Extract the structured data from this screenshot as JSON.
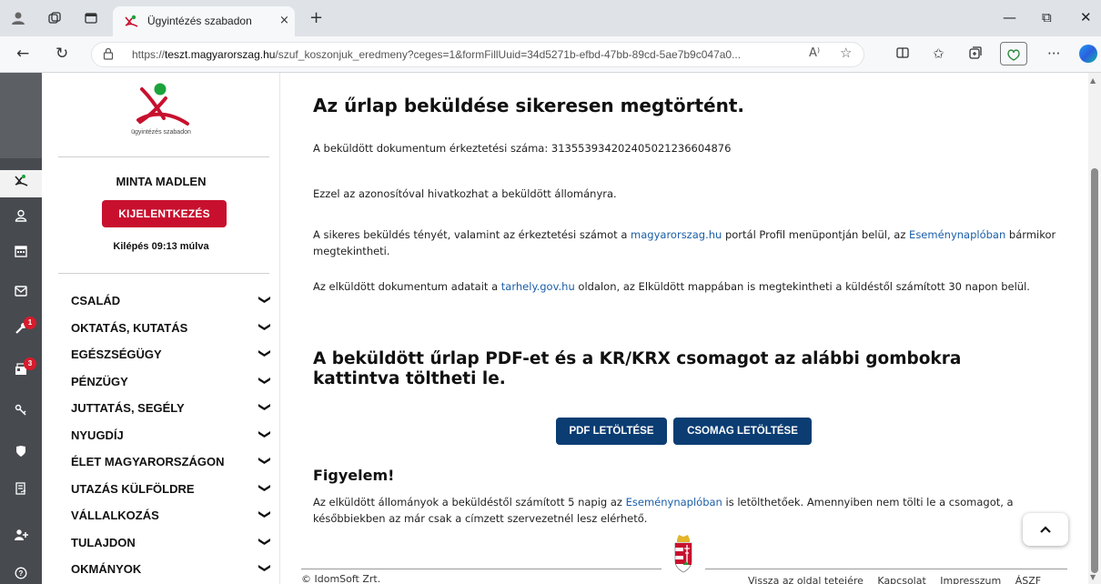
{
  "browser": {
    "tab_title": "Ügyintézés szabadon",
    "tab_close": "×",
    "new_tab": "+",
    "url_prefix": "https://",
    "url_host": "teszt.magyarorszag.hu",
    "url_rest": "/szuf_koszonjuk_eredmeny?ceges=1&formFillUuid=34d5271b-efbd-47bb-89cd-5ae7b9c047a0...",
    "read_aloud": "A⁾",
    "window_minimize": "—",
    "window_restore": "⧉",
    "window_close": "✕",
    "more": "···"
  },
  "rail": {
    "badges": {
      "tools": "1",
      "docs": "3"
    }
  },
  "sidebar": {
    "logo_text": "ügyintézés szabadon",
    "user_name": "MINTA MADLEN",
    "logout_label": "KIJELENTKEZÉS",
    "logout_timer": "Kilépés 09:13 múlva",
    "menu": [
      {
        "label": "CSALÁD"
      },
      {
        "label": "OKTATÁS, KUTATÁS"
      },
      {
        "label": "EGÉSZSÉGÜGY"
      },
      {
        "label": "PÉNZÜGY"
      },
      {
        "label": "JUTTATÁS, SEGÉLY"
      },
      {
        "label": "NYUGDÍJ"
      },
      {
        "label": "ÉLET MAGYARORSZÁGON"
      },
      {
        "label": "UTAZÁS KÜLFÖLDRE"
      },
      {
        "label": "VÁLLALKOZÁS"
      },
      {
        "label": "TULAJDON"
      },
      {
        "label": "OKMÁNYOK"
      }
    ]
  },
  "main": {
    "title": "Az űrlap beküldése sikeresen megtörtént.",
    "reg_number_text": "A beküldött dokumentum érkeztetési száma: 313553934202405021236604876",
    "reference_text": "Ezzel az azonosítóval hivatkozhat a beküldött állományra.",
    "profile_p1": "A sikeres beküldés tényét, valamint az érkeztetési számot a ",
    "profile_link1": "magyarorszag.hu",
    "profile_p2": " portál Profil menüpontján belül, az ",
    "profile_link2": "Eseménynaplóban",
    "profile_p3": " bármikor megtekintheti.",
    "tarhely_p1": "Az elküldött dokumentum adatait a ",
    "tarhely_link": "tarhely.gov.hu",
    "tarhely_p2": " oldalon, az Elküldött mappában is megtekintheti a küldéstől számított 30 napon belül.",
    "download_heading": "A beküldött űrlap PDF-et és a KR/KRX csomagot az alábbi gombokra kattintva töltheti le.",
    "pdf_button": "PDF LETÖLTÉSE",
    "package_button": "CSOMAG LETÖLTÉSE",
    "attention_heading": "Figyelem!",
    "attention_p1": "Az elküldött állományok a beküldéstől számított 5 napig az ",
    "attention_link": "Eseménynaplóban",
    "attention_p2": " is letölthetőek. Amennyiben nem tölti le a csomagot, a későbbiekben az már csak a címzett szervezetnél lesz elérhető."
  },
  "footer": {
    "copyright": "© IdomSoft Zrt.",
    "links": [
      "Vissza az oldal tetejére",
      "Kapcsolat",
      "Impresszum",
      "ÁSZF"
    ]
  },
  "colors": {
    "brand_red": "#c8102e",
    "button_blue": "#0b3d73",
    "link_blue": "#1a5ea8",
    "logo_green": "#1aa33b"
  }
}
